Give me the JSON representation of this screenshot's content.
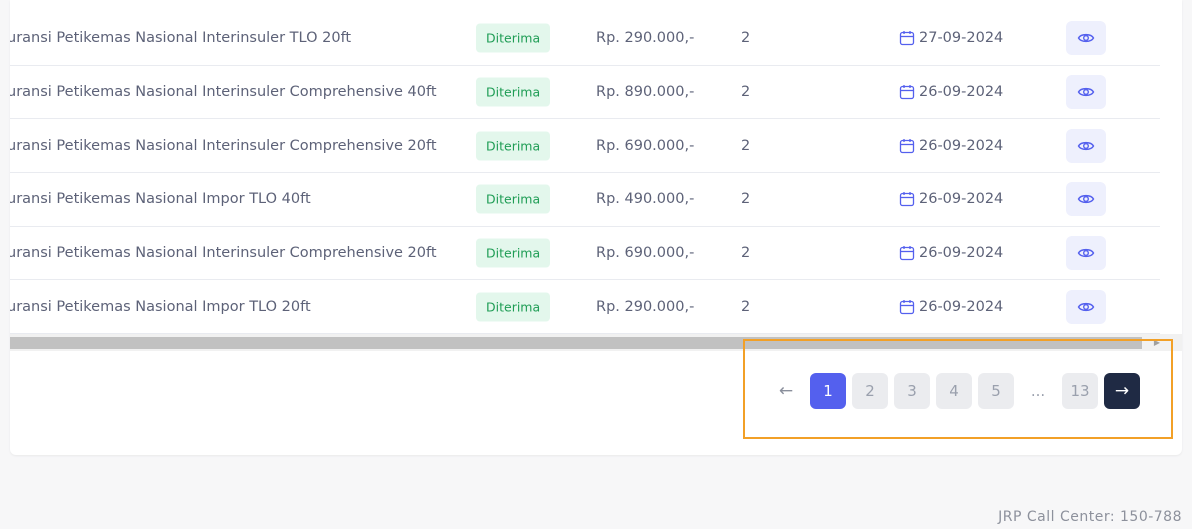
{
  "table": {
    "rows": [
      {
        "product": "uransi Petikemas Nasional Interinsuler TLO 20ft",
        "status": "Diterima",
        "price": "Rp. 290.000,-",
        "qty": "2",
        "date": "27-09-2024"
      },
      {
        "product": "uransi Petikemas Nasional Interinsuler Comprehensive 40ft",
        "status": "Diterima",
        "price": "Rp. 890.000,-",
        "qty": "2",
        "date": "26-09-2024"
      },
      {
        "product": "uransi Petikemas Nasional Interinsuler Comprehensive 20ft",
        "status": "Diterima",
        "price": "Rp. 690.000,-",
        "qty": "2",
        "date": "26-09-2024"
      },
      {
        "product": "uransi Petikemas Nasional Impor TLO 40ft",
        "status": "Diterima",
        "price": "Rp. 490.000,-",
        "qty": "2",
        "date": "26-09-2024"
      },
      {
        "product": "uransi Petikemas Nasional Interinsuler Comprehensive 20ft",
        "status": "Diterima",
        "price": "Rp. 690.000,-",
        "qty": "2",
        "date": "26-09-2024"
      },
      {
        "product": "uransi Petikemas Nasional Impor TLO 20ft",
        "status": "Diterima",
        "price": "Rp. 290.000,-",
        "qty": "2",
        "date": "26-09-2024"
      }
    ],
    "row_icons": {
      "date_icon": "calendar-icon",
      "view_icon": "eye-icon"
    }
  },
  "pagination": {
    "prev": "←",
    "pages": [
      "1",
      "2",
      "3",
      "4",
      "5"
    ],
    "ellipsis": "...",
    "last": "13",
    "next": "→",
    "current": "1"
  },
  "footer": {
    "text": "JRP Call Center: 150-788"
  },
  "colors": {
    "accent": "#5460ee",
    "status_bg": "#e3f7ec",
    "status_text": "#1f9d55",
    "next_bg": "#1f2a44",
    "highlight": "#f2a027"
  }
}
